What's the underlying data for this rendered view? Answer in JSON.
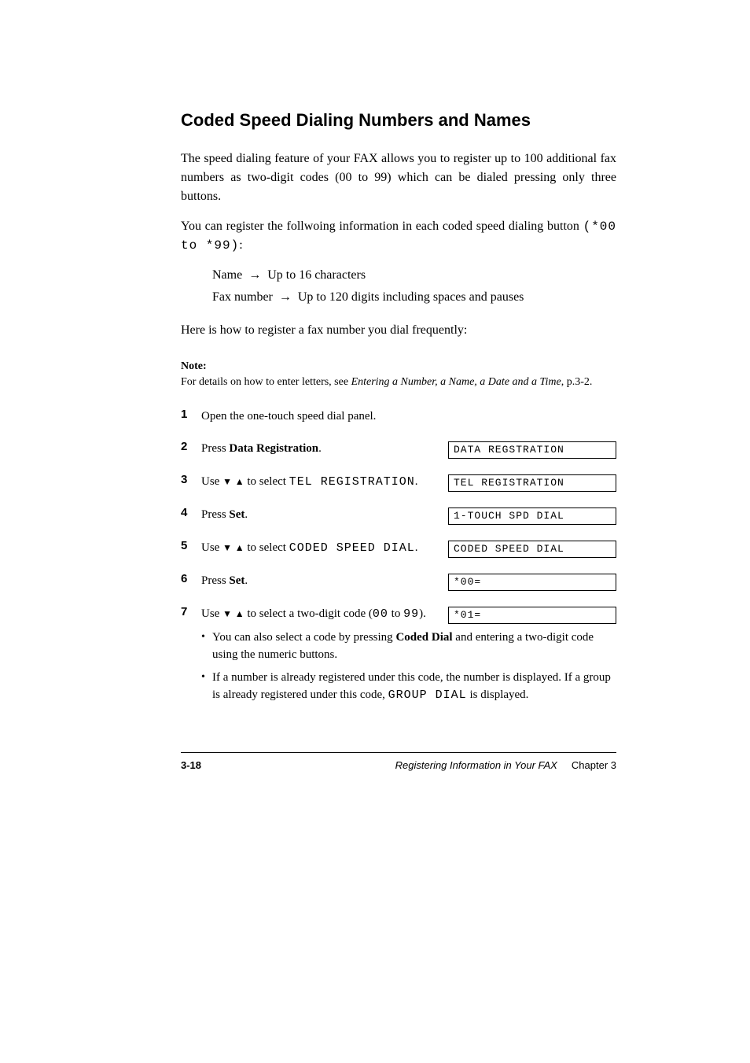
{
  "title": "Coded Speed Dialing Numbers and Names",
  "intro": {
    "p1": "The speed dialing feature of your FAX allows you to register up to 100 additional fax numbers as two-digit codes (00 to 99) which can be dialed pressing only three buttons.",
    "p2_prefix": "You can register the follwoing information in each coded speed dialing button ",
    "p2_code": "(*00 to *99)",
    "p2_suffix": ":"
  },
  "params": {
    "name": "Name",
    "name_detail": "Up to 16 characters",
    "fax": "Fax number",
    "fax_detail": "Up to 120 digits including spaces and pauses"
  },
  "howto": "Here is how to register a fax number you dial frequently:",
  "note": {
    "label": "Note:",
    "text_prefix": "For details on how to enter letters, see ",
    "text_link": "Entering a Number, a Name, a Date and a Time",
    "text_suffix": ", p.3-2."
  },
  "steps": [
    {
      "num": "1",
      "text": "Open the one-touch speed dial panel.",
      "displays": []
    },
    {
      "num": "2",
      "text_before": "Press ",
      "text_bold": "Data Registration",
      "text_after": ".",
      "displays": [
        "DATA REGSTRATION"
      ]
    },
    {
      "num": "3",
      "text_before": "Use ",
      "arrows": true,
      "text_mid": " to select ",
      "mono": "TEL REGISTRATION",
      "text_after": ".",
      "displays": [
        "TEL REGISTRATION"
      ]
    },
    {
      "num": "4",
      "text_before": "Press ",
      "text_bold": "Set",
      "text_after": ".",
      "displays": [
        "1-TOUCH SPD DIAL"
      ]
    },
    {
      "num": "5",
      "text_before": "Use ",
      "arrows": true,
      "text_mid": " to select ",
      "mono": "CODED SPEED DIAL",
      "text_after": ".",
      "displays": [
        "CODED SPEED DIAL"
      ]
    },
    {
      "num": "6",
      "text_before": "Press ",
      "text_bold": "Set",
      "text_after": ".",
      "displays": [
        "*00="
      ]
    },
    {
      "num": "7",
      "text_before": "Use ",
      "arrows": true,
      "text_mid": " to select a two-digit code (",
      "mono": "00",
      "text_mid2": " to ",
      "mono2": "99",
      "text_after": ").",
      "displays": [
        "*01="
      ],
      "bullet_prefix": "You can also select a code by pressing ",
      "bullet_bold": "Coded Dial",
      "bullet_suffix": " and entering a two-digit code using the numeric buttons.",
      "bullet2_prefix": "If a number is already registered under this code, the number is displayed. If a group is already registered under this code, ",
      "bullet2_mono": "GROUP DIAL",
      "bullet2_suffix": " is displayed."
    }
  ],
  "footer": {
    "page": "3-18",
    "chapter_prefix": "Registering Information in Your FAX",
    "chapter_suffix": "Chapter 3"
  },
  "glyphs": {
    "down": "▼",
    "up": "▲",
    "arrow_right": "→"
  }
}
